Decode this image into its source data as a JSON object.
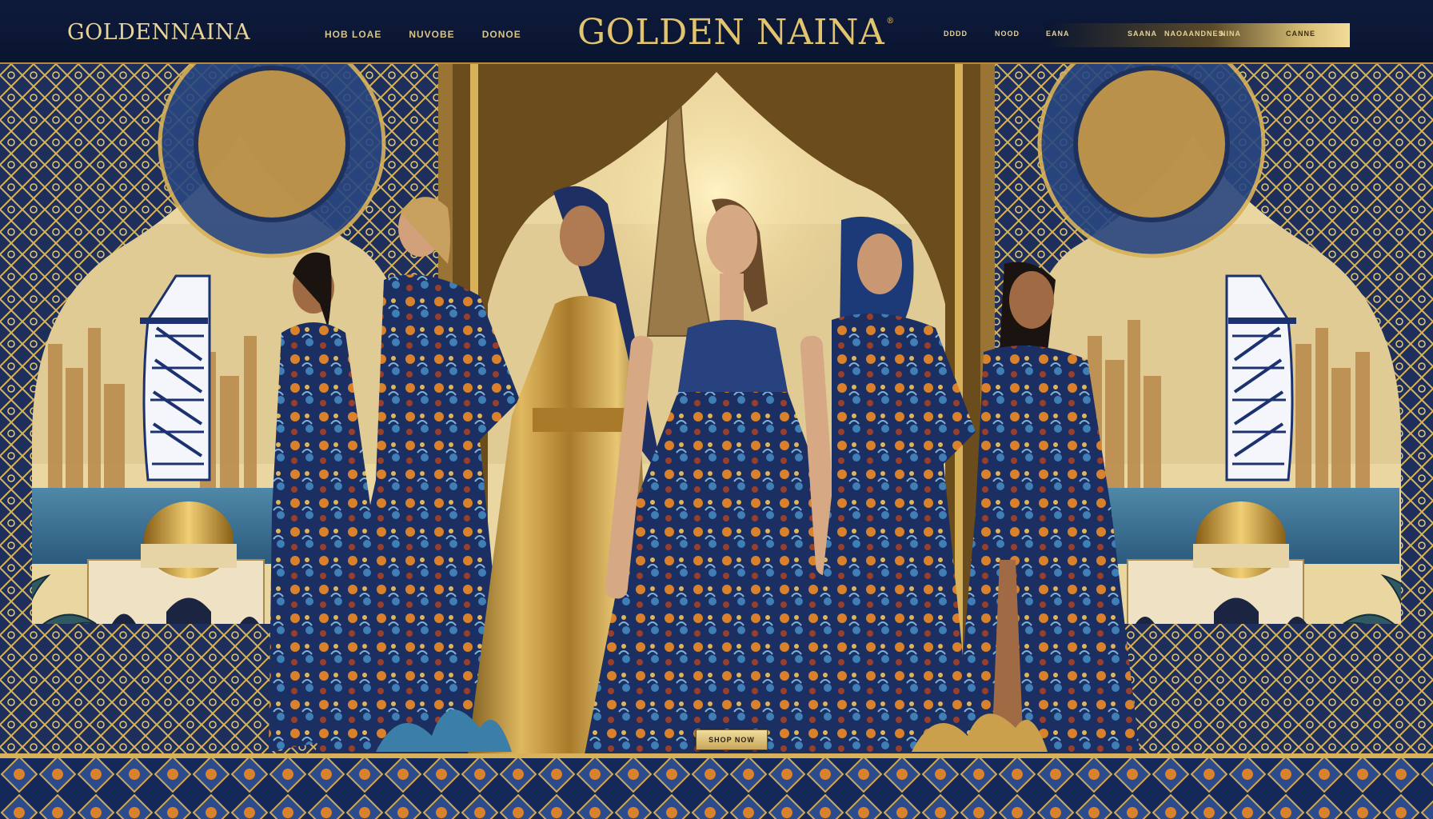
{
  "header": {
    "brand_left": "GOLDENNAINA",
    "brand_center": "GOLDEN NAINA",
    "brand_mark": "®",
    "nav_left": [
      "HOB LOAE",
      "NUVOBE",
      "DONOE"
    ],
    "nav_right": [
      "DDDD",
      "NOOD",
      "EANA",
      "SAANA",
      "NAOAANDNES",
      "NINA",
      "CANNE"
    ]
  },
  "hero": {
    "cta_label": "SHOP NOW",
    "icons": [
      "burj-al-arab-icon",
      "burj-khalifa-icon",
      "golden-dome-icon",
      "car-icon",
      "palm-icon"
    ]
  },
  "colors": {
    "navy": "#0b1733",
    "gold": "#e2c46e",
    "gold_dark": "#b48a3c",
    "royal_blue": "#1d3b7a",
    "sky": "#f1e3b2"
  }
}
